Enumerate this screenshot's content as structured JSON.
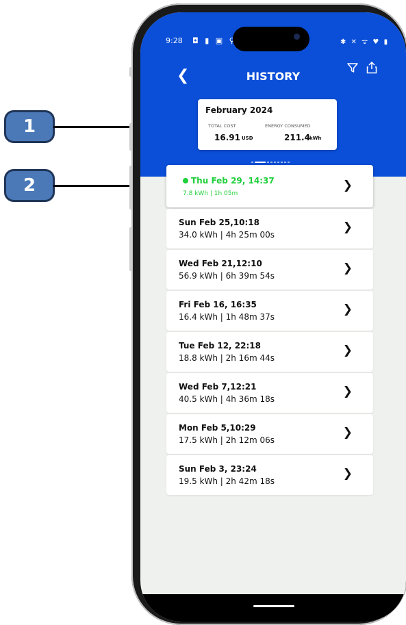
{
  "status": {
    "time": "9:28",
    "left_icons": "◘ ▮ ▣ ⚲",
    "right_icons": "✱ ✕ ᯤ ♥ ▮"
  },
  "header": {
    "back_icon": "chevron-left-icon",
    "title": "HISTORY",
    "filter_icon": "filter-icon",
    "share_icon": "share-icon"
  },
  "summary": {
    "month": "February 2024",
    "total_cost_label": "TOTAL COST",
    "total_cost_value": "16.91",
    "total_cost_unit": "USD",
    "energy_label": "ENERGY CONSUMED",
    "energy_value": "211.4",
    "energy_unit": "kWh"
  },
  "active_session": {
    "date": "Thu Feb 29, 14:37",
    "detail": "7.8 kWh | 1h 05m",
    "color": "#1fcf3b"
  },
  "sessions": [
    {
      "date": "Sun Feb 25,10:18",
      "detail": "34.0 kWh | 4h 25m 00s"
    },
    {
      "date": "Wed Feb 21,12:10",
      "detail": "56.9 kWh | 6h 39m 54s"
    },
    {
      "date": "Fri Feb 16, 16:35",
      "detail": "16.4 kWh | 1h 48m 37s"
    },
    {
      "date": "Tue Feb 12, 22:18",
      "detail": "18.8 kWh | 2h 16m 44s"
    },
    {
      "date": "Wed Feb 7,12:21",
      "detail": "40.5 kWh | 4h 36m 18s"
    },
    {
      "date": "Mon Feb 5,10:29",
      "detail": "17.5 kWh | 2h 12m 06s"
    },
    {
      "date": "Sun Feb 3, 23:24",
      "detail": "19.5 kWh | 2h 42m 18s"
    }
  ],
  "callouts": {
    "one": "1",
    "two": "2"
  },
  "colors": {
    "header": "#0b4fd8",
    "accent_green": "#1fcf3b",
    "callout": "#4b79b8"
  }
}
